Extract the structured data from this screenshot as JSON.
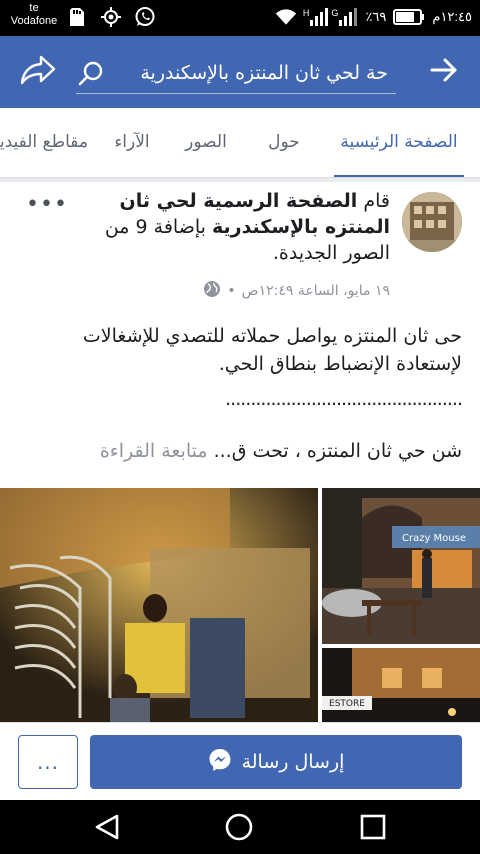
{
  "status_bar": {
    "carrier_line1": "te",
    "carrier_line2": "Vodafone",
    "battery": "٪٦٩",
    "time": "١٢:٤٥م",
    "network_h": "H",
    "network_g": "G",
    "icons_left": [
      "sd-card-icon",
      "gps-icon",
      "whatsapp-icon"
    ],
    "icons_right": [
      "wifi-icon",
      "signal-icon",
      "battery-icon"
    ]
  },
  "header": {
    "search_text": "حة لحي ثان المنتزه بالإسكندرية",
    "icons": [
      "share-icon",
      "search-icon",
      "back-arrow-icon"
    ],
    "bar_color": "#4267b2"
  },
  "tabs": {
    "items": [
      {
        "label": "الصفحة الرئيسية",
        "active": true
      },
      {
        "label": "حول",
        "active": false
      },
      {
        "label": "الصور",
        "active": false
      },
      {
        "label": "الآراء",
        "active": false
      },
      {
        "label": "مقاطع الفيديو",
        "active": false
      }
    ],
    "active_color": "#4267b2"
  },
  "post": {
    "header_prefix": "قام",
    "page_name": "الصفحة الرسمية لحي ثان المنتزه بالإسكندرية",
    "header_suffix": "بإضافة 9 من الصور الجديدة.",
    "timestamp": "١٩ مايو، الساعة ١٢:٤٩ص",
    "meta_separator": "•",
    "body": "حى ثان المنتزه يواصل حملاته للتصدي للإشغالات لإستعادة الإنضباط بنطاق الحي.",
    "dots": "...............................................",
    "snippet": "شن حي ثان المنتزه ، تحت ق...",
    "continue_reading": "متابعة القراءة",
    "more_label": "•••",
    "photo_labels": [
      "Crazy Mouse",
      "ESTORE"
    ]
  },
  "action_bar": {
    "more_label": "...",
    "message_label": "إرسال رسالة",
    "icons": [
      "messenger-icon"
    ]
  },
  "nav_bar": {
    "icons": [
      "back-triangle-icon",
      "home-circle-icon",
      "recents-square-icon"
    ]
  }
}
